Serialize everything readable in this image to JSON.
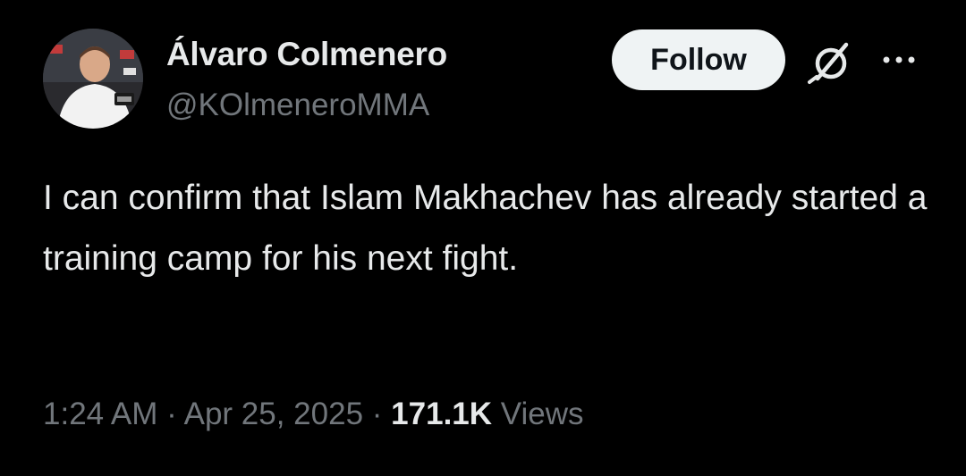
{
  "author": {
    "display_name": "Álvaro Colmenero",
    "handle": "@KOlmeneroMMA"
  },
  "actions": {
    "follow_label": "Follow",
    "grok_icon": "grok-slash-circle-icon",
    "more_icon": "more-horizontal-icon"
  },
  "tweet": {
    "text": "I can confirm that Islam Makhachev has already started a training camp for his next fight."
  },
  "meta": {
    "time": "1:24 AM",
    "separator": "·",
    "date": "Apr 25, 2025",
    "views_count": "171.1K",
    "views_label": "Views"
  },
  "colors": {
    "background": "#000000",
    "primary_text": "#e7e9ea",
    "secondary_text": "#71767b",
    "follow_button_bg": "#eff3f4",
    "follow_button_text": "#0f1419"
  }
}
